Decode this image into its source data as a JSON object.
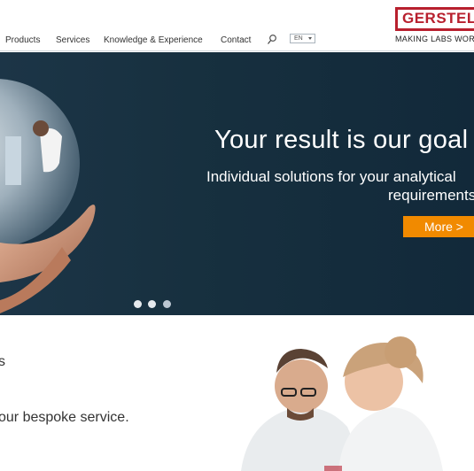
{
  "nav": {
    "products": "Products",
    "services": "Services",
    "knowledge": "Knowledge & Experience",
    "contact": "Contact",
    "language": "EN"
  },
  "logo": {
    "name": "GERSTEL",
    "tagline": "MAKING LABS WORK"
  },
  "hero": {
    "title": "Your result is our goal",
    "subtitle_line1": "Individual solutions for your analytical",
    "subtitle_line2": "requirements",
    "cta": "More >",
    "slides": 3,
    "active_slide": 3
  },
  "lower": {
    "heading_fragment": "s",
    "text": "our bespoke service."
  },
  "colors": {
    "brand_red": "#b8202e",
    "cta_orange": "#f18a00",
    "hero_bg": "#17303f"
  },
  "icons": {
    "search": "search-icon",
    "language_caret": "chevron-down-icon"
  }
}
